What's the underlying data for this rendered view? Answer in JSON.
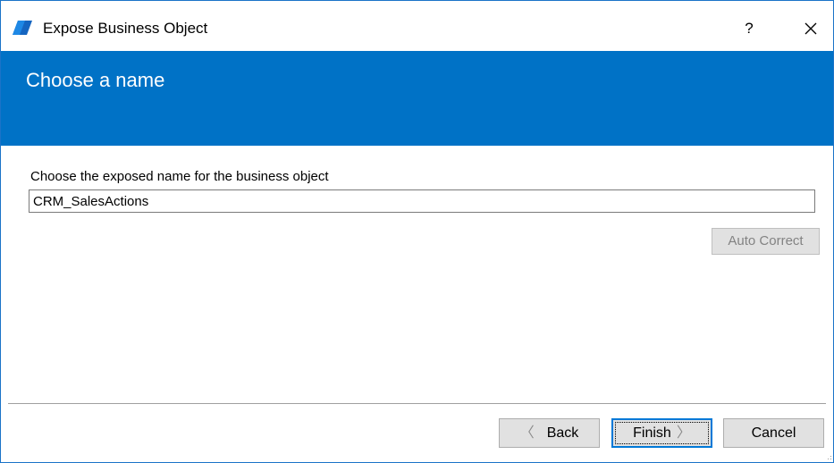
{
  "window": {
    "title": "Expose Business Object",
    "help_label": "?",
    "app_icon": "blue-parallelogram-icon",
    "close_icon": "close-icon"
  },
  "header": {
    "title": "Choose a name",
    "background_color": "#0072c6"
  },
  "form": {
    "label": "Choose the exposed name for the business object",
    "name_value": "CRM_SalesActions",
    "auto_correct_label": "Auto Correct",
    "auto_correct_enabled": false
  },
  "footer": {
    "back_label": "Back",
    "back_enabled": false,
    "back_icon": "chevron-left-icon",
    "finish_label": "Finish",
    "finish_icon": "chevron-right-icon",
    "cancel_label": "Cancel"
  }
}
